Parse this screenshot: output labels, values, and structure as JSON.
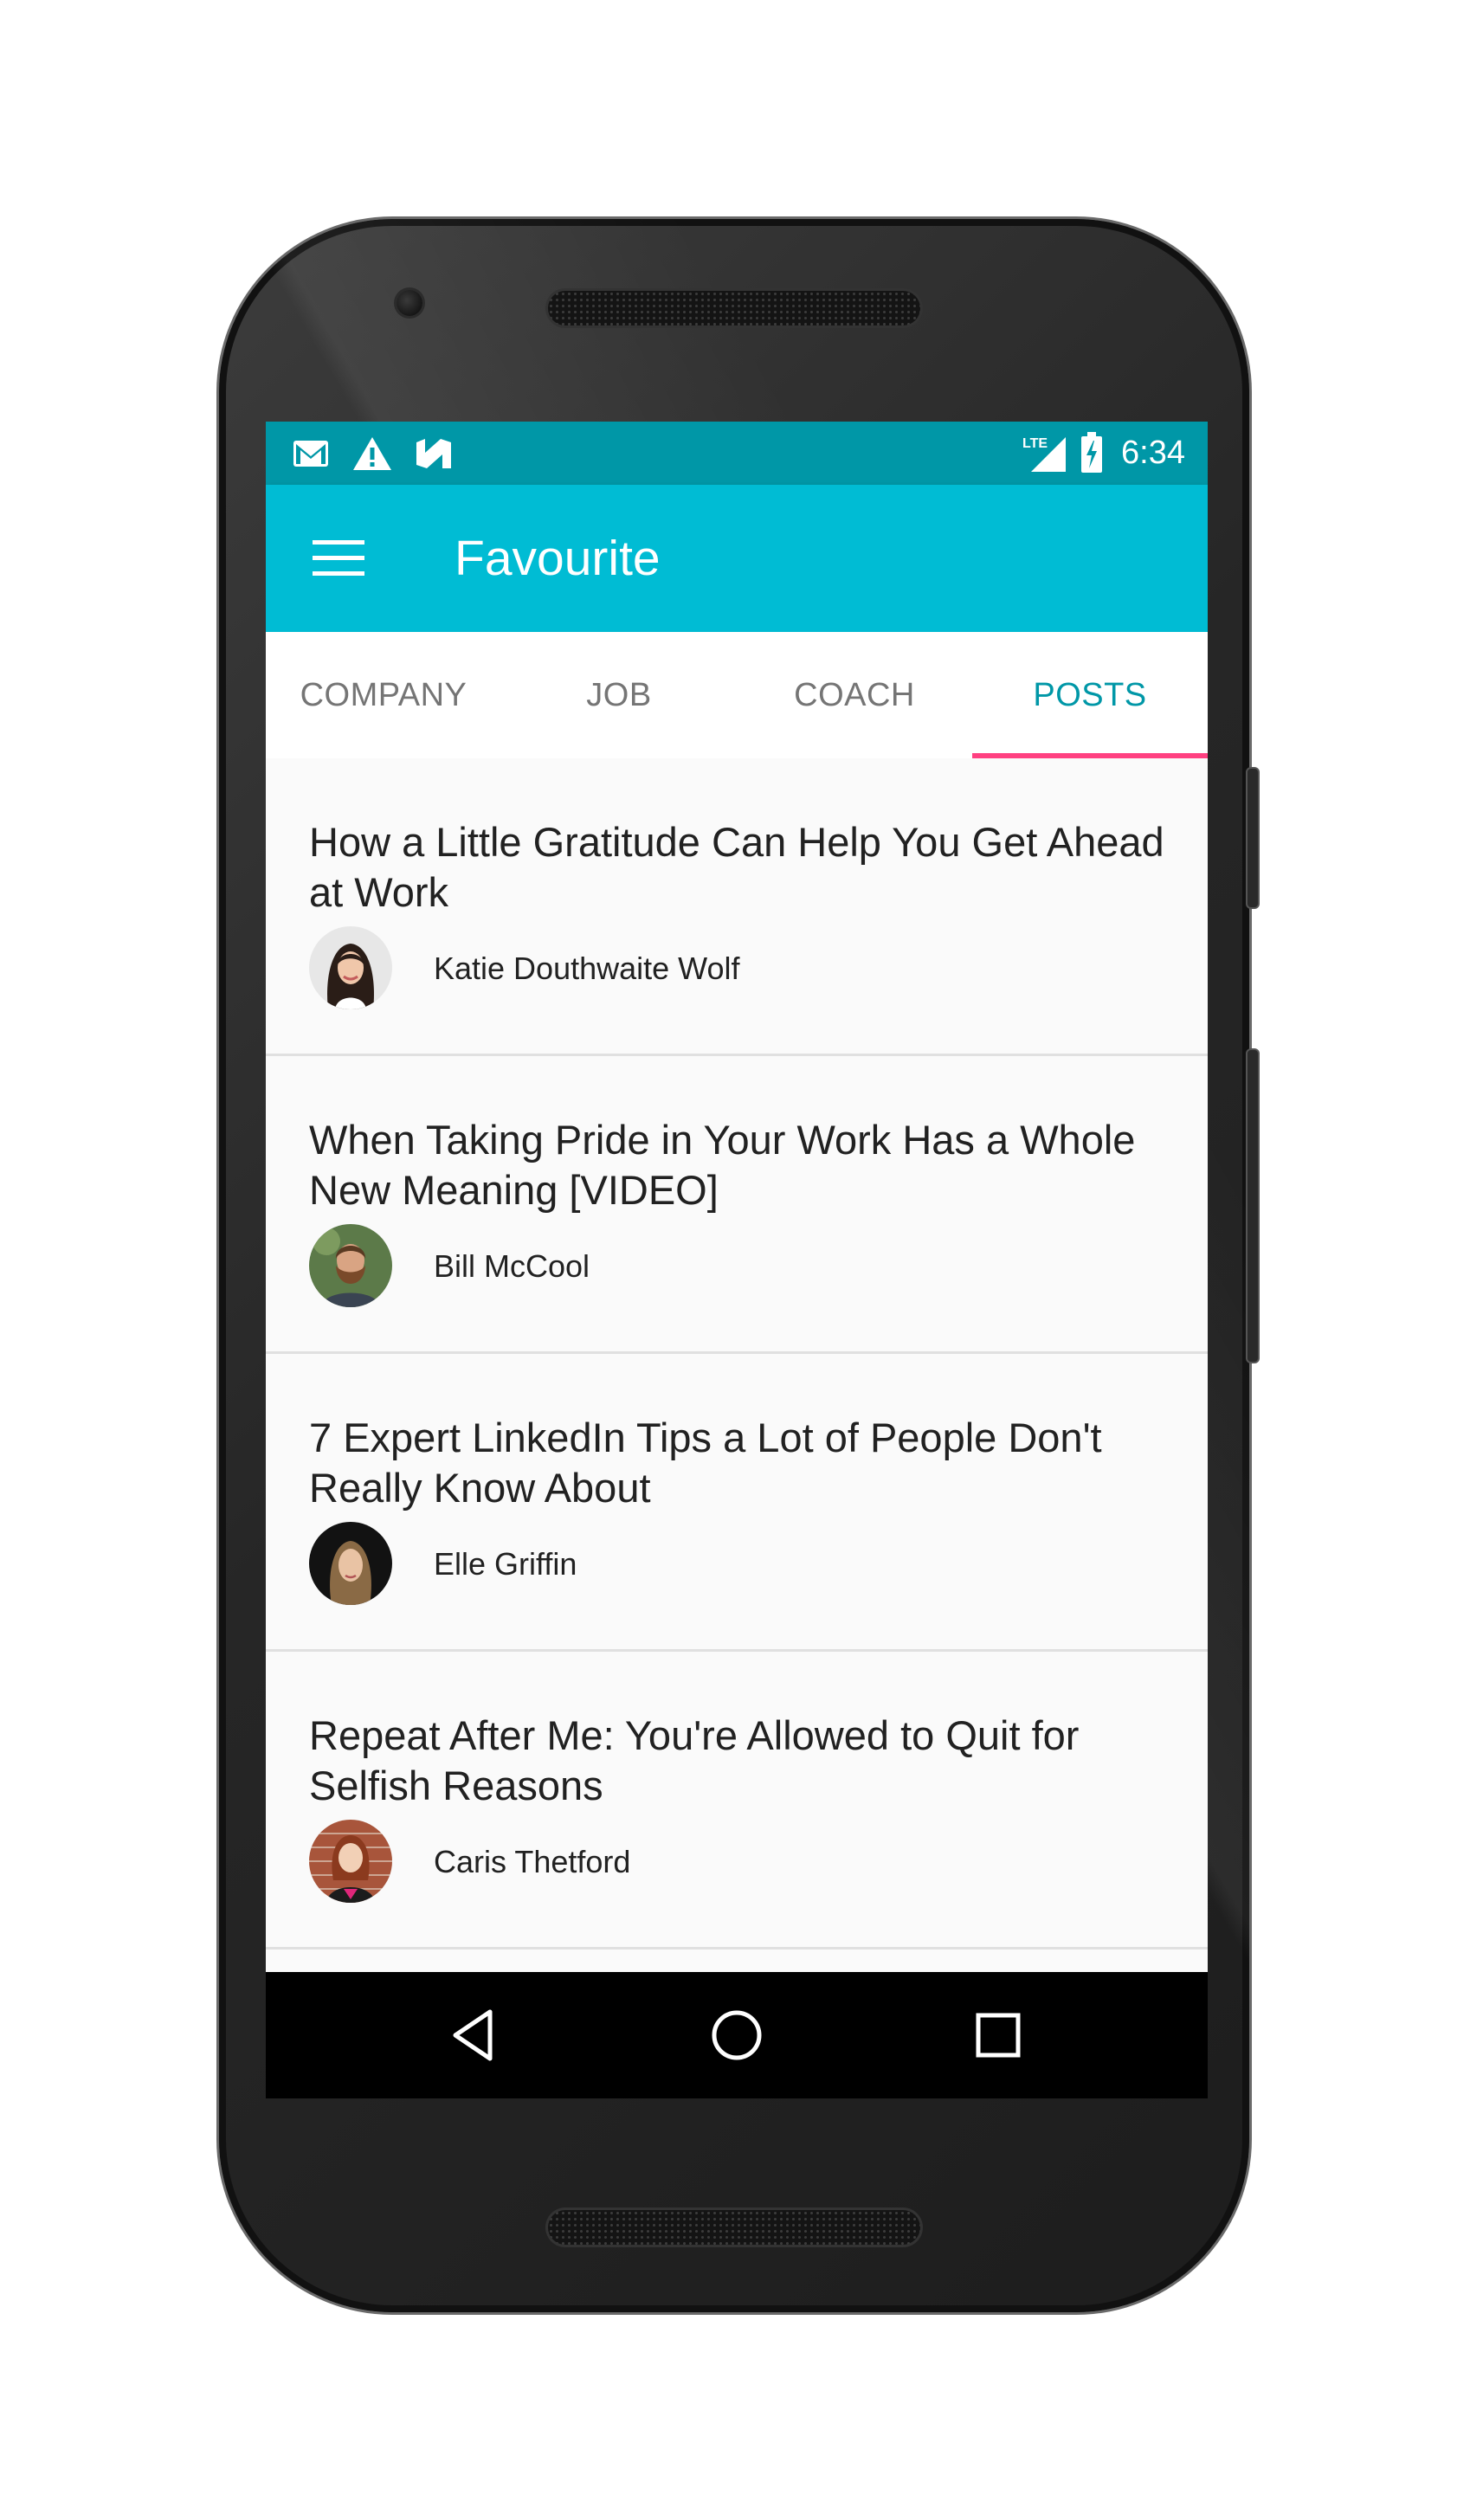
{
  "status_bar": {
    "time": "6:34",
    "network": "LTE",
    "icons": [
      "gmail-icon",
      "warning-icon",
      "n-notification-icon",
      "signal-icon",
      "battery-charging-icon"
    ]
  },
  "app_bar": {
    "title": "Favourite",
    "menu_icon": "hamburger-menu-icon",
    "color": "#00bcd4",
    "status_color": "#0097a7"
  },
  "tabs": [
    {
      "label": "COMPANY",
      "active": false
    },
    {
      "label": "JOB",
      "active": false
    },
    {
      "label": "COACH",
      "active": false
    },
    {
      "label": "POSTS",
      "active": true
    }
  ],
  "tab_indicator_color": "#ff4081",
  "posts": [
    {
      "title": "How a Little Gratitude Can Help You Get Ahead at Work",
      "author": "Katie Douthwaite Wolf",
      "avatar": "avatar-woman-dark-hair"
    },
    {
      "title": "When Taking Pride in Your Work Has a Whole New Meaning [VIDEO]",
      "author": "Bill McCool",
      "avatar": "avatar-bearded-man"
    },
    {
      "title": "7 Expert LinkedIn Tips a Lot of People Don't Really Know About",
      "author": "Elle Griffin",
      "avatar": "avatar-woman-dark-background"
    },
    {
      "title": "Repeat After Me: You're Allowed to Quit for Selfish Reasons",
      "author": "Caris Thetford",
      "avatar": "avatar-woman-brick-wall"
    }
  ],
  "nav_bar": {
    "buttons": [
      "back-icon",
      "home-icon",
      "recents-icon"
    ]
  }
}
